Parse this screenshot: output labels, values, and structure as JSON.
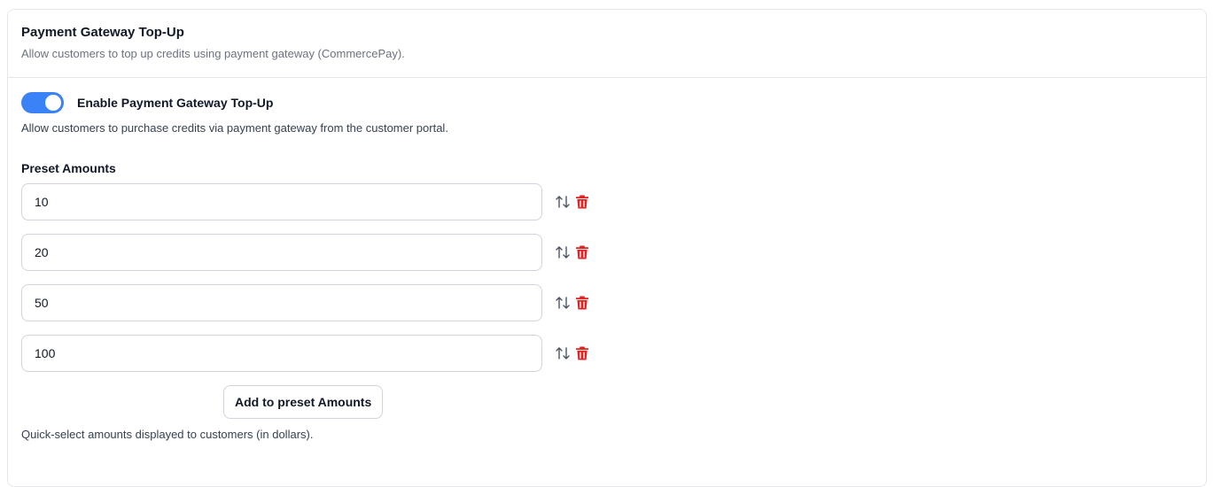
{
  "header": {
    "title": "Payment Gateway Top-Up",
    "subtitle": "Allow customers to top up credits using payment gateway (CommercePay)."
  },
  "toggle": {
    "label": "Enable Payment Gateway Top-Up",
    "enabled": true,
    "description": "Allow customers to purchase credits via payment gateway from the customer portal."
  },
  "preset": {
    "label": "Preset Amounts",
    "amounts": [
      "10",
      "20",
      "50",
      "100"
    ],
    "add_button_label": "Add to preset Amounts",
    "helper": "Quick-select amounts displayed to customers (in dollars)."
  },
  "icons": {
    "reorder": "arrows-up-down-icon",
    "delete": "trash-icon"
  },
  "colors": {
    "accent": "#3b82f6",
    "danger": "#dc2626"
  }
}
